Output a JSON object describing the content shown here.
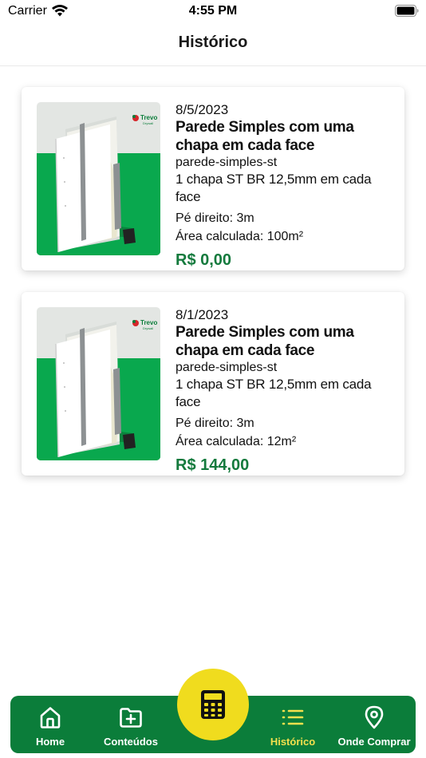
{
  "status_bar": {
    "carrier": "Carrier",
    "time": "4:55 PM"
  },
  "header": {
    "title": "Histórico"
  },
  "history": [
    {
      "date": "8/5/2023",
      "title": "Parede Simples com uma chapa em cada face",
      "slug": "parede-simples-st",
      "description": "1 chapa ST BR 12,5mm em cada face",
      "ceiling_height": "Pé direito: 3m",
      "area": "Área calculada: 100m²",
      "price": "R$ 0,00",
      "brand_logo": "Trevo"
    },
    {
      "date": "8/1/2023",
      "title": "Parede Simples com uma chapa em cada face",
      "slug": "parede-simples-st",
      "description": "1 chapa ST BR 12,5mm em cada face",
      "ceiling_height": "Pé direito: 3m",
      "area": "Área calculada: 12m²",
      "price": "R$ 144,00",
      "brand_logo": "Trevo"
    }
  ],
  "nav": {
    "home": "Home",
    "conteudos": "Conteúdos",
    "historico": "Histórico",
    "onde_comprar": "Onde Comprar",
    "calculator_icon": "calculator-icon"
  },
  "colors": {
    "brand_green": "#0b7d3a",
    "accent_yellow": "#f0dc1e",
    "price_green": "#147a3d",
    "active_tab": "#f4e04d"
  }
}
